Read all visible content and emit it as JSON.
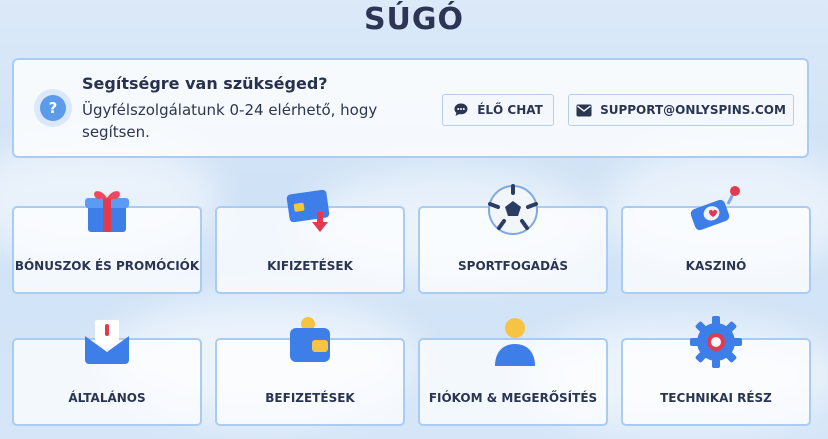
{
  "page_title": "SÚGÓ",
  "help": {
    "title": "Segítségre van szükséged?",
    "description": "Ügyfélszolgálatunk 0-24 elérhető, hogy segítsen.",
    "chat_label": "ÉLŐ CHAT",
    "email_label": "SUPPORT@ONLYSPINS.COM"
  },
  "categories": [
    {
      "label": "BÓNUSZOK ÉS PROMÓCIÓK",
      "icon": "gift-icon"
    },
    {
      "label": "KIFIZETÉSEK",
      "icon": "credit-card-icon"
    },
    {
      "label": "SPORTFOGADÁS",
      "icon": "soccer-ball-icon"
    },
    {
      "label": "KASZINÓ",
      "icon": "slot-machine-icon"
    },
    {
      "label": "ÁLTALÁNOS",
      "icon": "envelope-icon"
    },
    {
      "label": "BEFIZETÉSEK",
      "icon": "wallet-icon"
    },
    {
      "label": "FIÓKOM & MEGERŐSÍTÉS",
      "icon": "user-icon"
    },
    {
      "label": "TECHNIKAI RÉSZ",
      "icon": "gear-icon"
    }
  ],
  "colors": {
    "accent": "#5b9bea",
    "card_border": "#a9cdf2",
    "text": "#2a3552"
  }
}
